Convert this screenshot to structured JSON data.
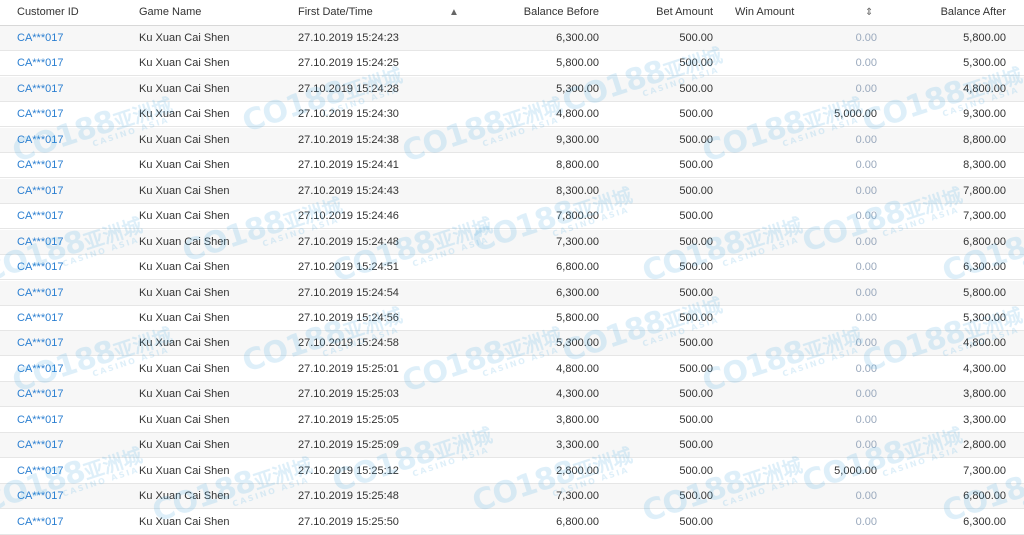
{
  "columns": {
    "customer_id": "Customer ID",
    "game_name": "Game Name",
    "first_date": "First Date/Time",
    "balance_before": "Balance Before",
    "bet_amount": "Bet Amount",
    "win_amount": "Win Amount",
    "balance_after": "Balance After"
  },
  "icons": {
    "date_sort": "sort-ascending-icon",
    "win_sort": "sort-toggle-icon"
  },
  "colors": {
    "link": "#2b7fd1",
    "zero_win": "#9aa9bd",
    "watermark": "#3aa3e0"
  },
  "watermark": {
    "text": "CO188",
    "cn": "亚洲城",
    "sub": "CASINO ASIA"
  },
  "rows": [
    {
      "id": "CA***017",
      "game": "Ku Xuan Cai Shen",
      "date": "27.10.2019 15:24:23",
      "before": "6,300.00",
      "bet": "500.00",
      "win": "0.00",
      "after": "5,800.00"
    },
    {
      "id": "CA***017",
      "game": "Ku Xuan Cai Shen",
      "date": "27.10.2019 15:24:25",
      "before": "5,800.00",
      "bet": "500.00",
      "win": "0.00",
      "after": "5,300.00"
    },
    {
      "id": "CA***017",
      "game": "Ku Xuan Cai Shen",
      "date": "27.10.2019 15:24:28",
      "before": "5,300.00",
      "bet": "500.00",
      "win": "0.00",
      "after": "4,800.00"
    },
    {
      "id": "CA***017",
      "game": "Ku Xuan Cai Shen",
      "date": "27.10.2019 15:24:30",
      "before": "4,800.00",
      "bet": "500.00",
      "win": "5,000.00",
      "after": "9,300.00"
    },
    {
      "id": "CA***017",
      "game": "Ku Xuan Cai Shen",
      "date": "27.10.2019 15:24:38",
      "before": "9,300.00",
      "bet": "500.00",
      "win": "0.00",
      "after": "8,800.00"
    },
    {
      "id": "CA***017",
      "game": "Ku Xuan Cai Shen",
      "date": "27.10.2019 15:24:41",
      "before": "8,800.00",
      "bet": "500.00",
      "win": "0.00",
      "after": "8,300.00"
    },
    {
      "id": "CA***017",
      "game": "Ku Xuan Cai Shen",
      "date": "27.10.2019 15:24:43",
      "before": "8,300.00",
      "bet": "500.00",
      "win": "0.00",
      "after": "7,800.00"
    },
    {
      "id": "CA***017",
      "game": "Ku Xuan Cai Shen",
      "date": "27.10.2019 15:24:46",
      "before": "7,800.00",
      "bet": "500.00",
      "win": "0.00",
      "after": "7,300.00"
    },
    {
      "id": "CA***017",
      "game": "Ku Xuan Cai Shen",
      "date": "27.10.2019 15:24:48",
      "before": "7,300.00",
      "bet": "500.00",
      "win": "0.00",
      "after": "6,800.00"
    },
    {
      "id": "CA***017",
      "game": "Ku Xuan Cai Shen",
      "date": "27.10.2019 15:24:51",
      "before": "6,800.00",
      "bet": "500.00",
      "win": "0.00",
      "after": "6,300.00"
    },
    {
      "id": "CA***017",
      "game": "Ku Xuan Cai Shen",
      "date": "27.10.2019 15:24:54",
      "before": "6,300.00",
      "bet": "500.00",
      "win": "0.00",
      "after": "5,800.00"
    },
    {
      "id": "CA***017",
      "game": "Ku Xuan Cai Shen",
      "date": "27.10.2019 15:24:56",
      "before": "5,800.00",
      "bet": "500.00",
      "win": "0.00",
      "after": "5,300.00"
    },
    {
      "id": "CA***017",
      "game": "Ku Xuan Cai Shen",
      "date": "27.10.2019 15:24:58",
      "before": "5,300.00",
      "bet": "500.00",
      "win": "0.00",
      "after": "4,800.00"
    },
    {
      "id": "CA***017",
      "game": "Ku Xuan Cai Shen",
      "date": "27.10.2019 15:25:01",
      "before": "4,800.00",
      "bet": "500.00",
      "win": "0.00",
      "after": "4,300.00"
    },
    {
      "id": "CA***017",
      "game": "Ku Xuan Cai Shen",
      "date": "27.10.2019 15:25:03",
      "before": "4,300.00",
      "bet": "500.00",
      "win": "0.00",
      "after": "3,800.00"
    },
    {
      "id": "CA***017",
      "game": "Ku Xuan Cai Shen",
      "date": "27.10.2019 15:25:05",
      "before": "3,800.00",
      "bet": "500.00",
      "win": "0.00",
      "after": "3,300.00"
    },
    {
      "id": "CA***017",
      "game": "Ku Xuan Cai Shen",
      "date": "27.10.2019 15:25:09",
      "before": "3,300.00",
      "bet": "500.00",
      "win": "0.00",
      "after": "2,800.00"
    },
    {
      "id": "CA***017",
      "game": "Ku Xuan Cai Shen",
      "date": "27.10.2019 15:25:12",
      "before": "2,800.00",
      "bet": "500.00",
      "win": "5,000.00",
      "after": "7,300.00"
    },
    {
      "id": "CA***017",
      "game": "Ku Xuan Cai Shen",
      "date": "27.10.2019 15:25:48",
      "before": "7,300.00",
      "bet": "500.00",
      "win": "0.00",
      "after": "6,800.00"
    },
    {
      "id": "CA***017",
      "game": "Ku Xuan Cai Shen",
      "date": "27.10.2019 15:25:50",
      "before": "6,800.00",
      "bet": "500.00",
      "win": "0.00",
      "after": "6,300.00"
    }
  ]
}
